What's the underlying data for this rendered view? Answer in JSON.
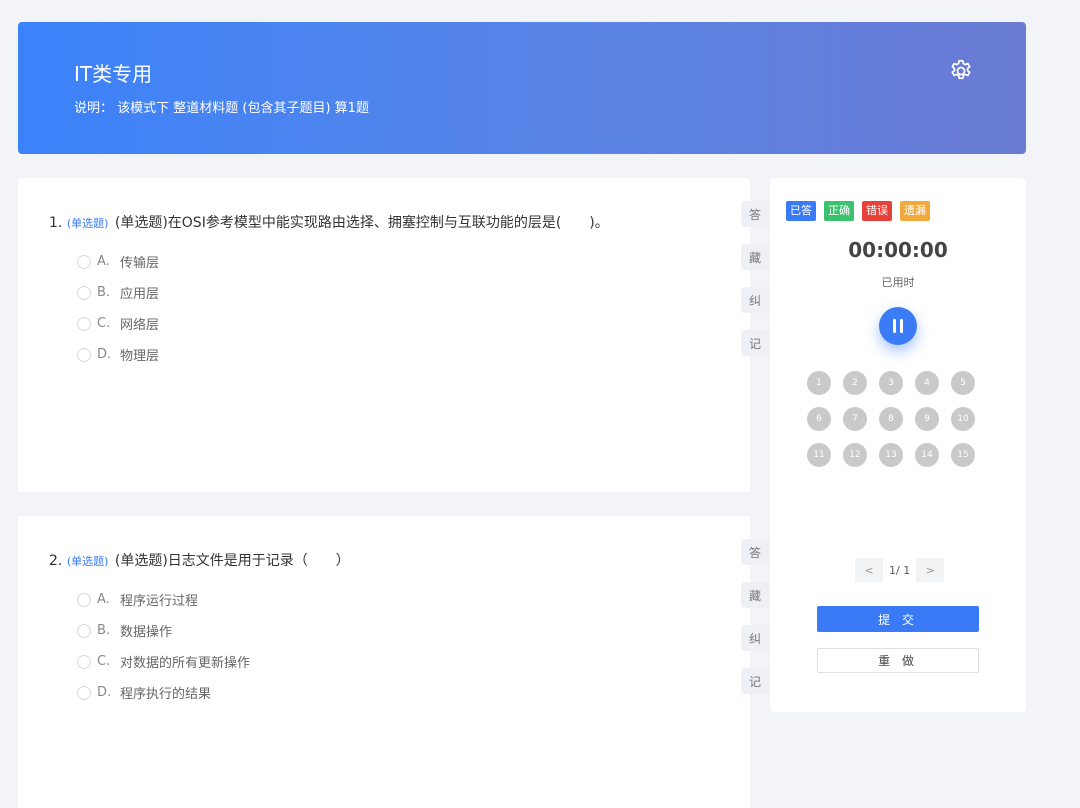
{
  "banner": {
    "title": "IT类专用",
    "description": "说明： 该模式下 整道材料题 (包含其子题目) 算1题",
    "settings_icon": "gear-icon"
  },
  "questions": [
    {
      "number": "1.",
      "type_tag": "(单选题)",
      "text": "(单选题)在OSI参考模型中能实现路由选择、拥塞控制与互联功能的层是(　　)。",
      "options": [
        {
          "letter": "A.",
          "text": "传输层"
        },
        {
          "letter": "B.",
          "text": "应用层"
        },
        {
          "letter": "C.",
          "text": "网络层"
        },
        {
          "letter": "D.",
          "text": "物理层"
        }
      ],
      "actions": [
        "答",
        "藏",
        "纠",
        "记"
      ]
    },
    {
      "number": "2.",
      "type_tag": "(单选题)",
      "text": "(单选题)日志文件是用于记录（　　）",
      "options": [
        {
          "letter": "A.",
          "text": "程序运行过程"
        },
        {
          "letter": "B.",
          "text": "数据操作"
        },
        {
          "letter": "C.",
          "text": "对数据的所有更新操作"
        },
        {
          "letter": "D.",
          "text": "程序执行的结果"
        }
      ],
      "actions": [
        "答",
        "藏",
        "纠",
        "记"
      ]
    }
  ],
  "panel": {
    "legend": [
      {
        "label": "已答",
        "color": "#3a7af6"
      },
      {
        "label": "正确",
        "color": "#3cc16e"
      },
      {
        "label": "错误",
        "color": "#e8413a"
      },
      {
        "label": "遗漏",
        "color": "#f2a93b"
      }
    ],
    "timer": "00:00:00",
    "timer_label": "已用时",
    "numbers": [
      "1",
      "2",
      "3",
      "4",
      "5",
      "6",
      "7",
      "8",
      "9",
      "10",
      "11",
      "12",
      "13",
      "14",
      "15"
    ],
    "pager": {
      "prev": "<",
      "info": "1/ 1",
      "next": ">"
    },
    "submit_label": "提 交",
    "redo_label": "重 做"
  },
  "colors": {
    "accent": "#3a7af6",
    "number_circle": "#c9c9c9"
  }
}
